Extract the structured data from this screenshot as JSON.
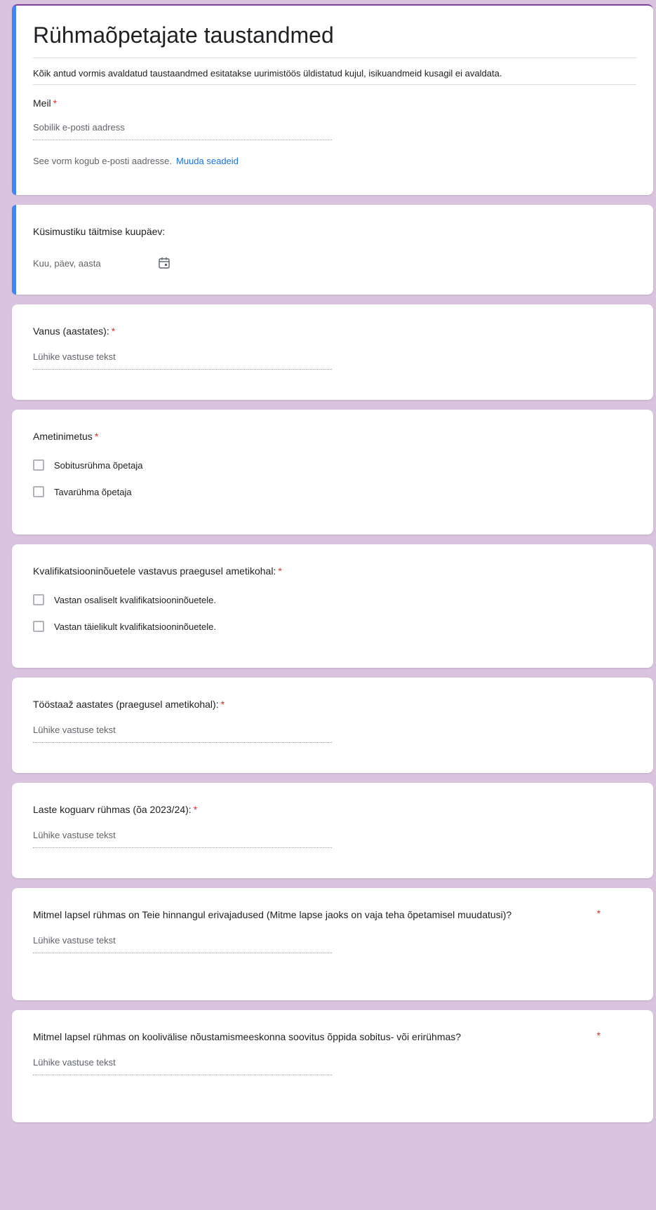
{
  "form": {
    "title": "Rühmaõpetajate taustandmed",
    "description": "Kõik antud vormis avaldatud taustaandmed esitatakse uurimistöös üldistatud kujul, isikuandmeid kusagil ei avaldata.",
    "email": {
      "label": "Meil",
      "required_mark": "*",
      "placeholder": "Sobilik e-posti aadress",
      "help_text": "See vorm kogub e-posti aadresse.",
      "settings_link": "Muuda seadeid"
    },
    "date_question": {
      "label": "Küsimustiku täitmise kuupäev:",
      "placeholder": "Kuu, päev, aasta",
      "icon": "calendar-icon"
    },
    "age_question": {
      "label": "Vanus (aastates):",
      "required_mark": "*",
      "placeholder": "Lühike vastuse tekst"
    },
    "position_question": {
      "label": "Ametinimetus",
      "required_mark": "*",
      "options": [
        "Sobitusrühma õpetaja",
        "Tavarühma õpetaja"
      ]
    },
    "qualification_question": {
      "label": "Kvalifikatsiooninõuetele vastavus praegusel ametikohal:",
      "required_mark": "*",
      "options": [
        "Vastan osaliselt kvalifikatsiooninõuetele.",
        "Vastan täielikult kvalifikatsiooninõuetele."
      ]
    },
    "tenure_question": {
      "label": "Tööstaaž aastates (praegusel ametikohal):",
      "required_mark": "*",
      "placeholder": "Lühike vastuse tekst"
    },
    "children_question": {
      "label": "Laste koguarv rühmas (õa 2023/24):",
      "required_mark": "*",
      "placeholder": "Lühike vastuse tekst"
    },
    "special_needs_question": {
      "label": "Mitmel lapsel rühmas on Teie hinnangul erivajadused (Mitme lapse jaoks on vaja teha õpetamisel muudatusi)?",
      "required_mark": "*",
      "placeholder": "Lühike vastuse tekst"
    },
    "counseling_question": {
      "label": "Mitmel lapsel rühmas on koolivälise nõustamismeeskonna soovitus õppida sobitus- või erirühmas?",
      "required_mark": "*",
      "placeholder": "Lühike vastuse tekst"
    }
  },
  "colors": {
    "background": "#d9c3df",
    "accent": "#4285f4",
    "required": "#d93025",
    "link": "#1a73e8",
    "theme_top": "#7b3f9a"
  }
}
